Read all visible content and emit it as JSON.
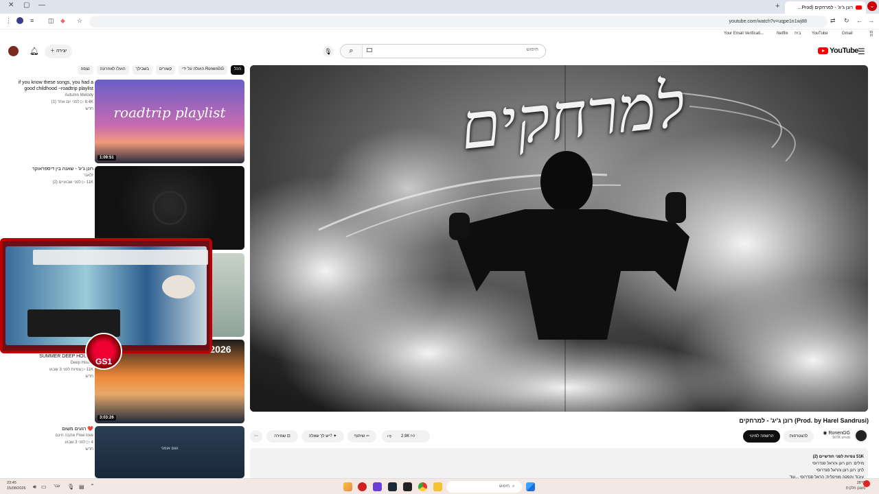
{
  "browser": {
    "tab_title": "רונן ג'יג' - למרחקים (Prod...",
    "url": "youtube.com/watch?v=uqpe1n1wj88",
    "bookmarks": [
      "Your Email Verificati...",
      "Netflix",
      "בית",
      "YouTube",
      "Gmail"
    ]
  },
  "header": {
    "search_placeholder": "חיפוש",
    "create_label": "יצירה",
    "logo_text": "YouTube"
  },
  "chips": [
    "הכל",
    "RonenGG",
    "הועלה על ידי",
    "קשורים",
    "בשבילך",
    "הועלו לאחרונה",
    "נצפה"
  ],
  "recommendations": [
    {
      "title": "if you know these songs, you had a good childhood ~roadtrip playlist",
      "channel": "Autumn Melody",
      "stats": "8.4K ▷ לפני יום אחד (1)",
      "badge": "חדש",
      "duration": "1:09:51",
      "thumb_text": "roadtrip playlist"
    },
    {
      "title": "רונן ג'יג' - שאנה בין דיספראוקר",
      "channel": "זלאנר",
      "stats": "11K ▷ לפני שבועיים (2)",
      "badge": "",
      "duration": "",
      "thumb_text": ""
    },
    {
      "title": "",
      "channel": "",
      "stats": "",
      "badge": "",
      "duration": "",
      "thumb_text": ""
    },
    {
      "title": "SUMMER DEEP HOUSE",
      "channel": "Deep House",
      "stats": "11K ▷ צפיות לפני 3 שבוע",
      "badge": "חדש",
      "duration": "3:03:26",
      "thumb_text": "MIX TOP 2026"
    },
    {
      "title": "❤️ רגעים משום",
      "channel": "Free love אהבה חינם",
      "stats": "4 ▷ לפני 3 שבוע",
      "badge": "חדש",
      "duration": "",
      "thumb_text": "ושם אומני"
    }
  ],
  "video": {
    "title": "רונן ג'יג' - למרחקים (Prod. by Harel Sandrusi)",
    "overlay_title": "למרחקים",
    "channel": "RonenGG",
    "subscribers": "507K מנויים",
    "subscribe_label": "הרשמה למינוי",
    "join_label": "להצטרפות",
    "likes": "2.9K",
    "share_label": "שיתוף",
    "ask_label": "יש לך שאלה?",
    "save_label": "שמירה",
    "more_label": "⋯"
  },
  "description": {
    "line1": "51K צפיות  לפני חודשיים (2)",
    "line2": "מילים: רונן רונן והראל סנדרוסי",
    "line3": "לחן: רונן רונן והראל סנדרוסי",
    "line4": "עיבוד והפקה מוזיקלית: הראל סנדרוסי ...עוד"
  },
  "overlay": {
    "badge_text": "GS1"
  },
  "taskbar": {
    "time": "23:45",
    "date": "15/08/2026",
    "search_placeholder": "חיפוש",
    "weather_temp": "28°C",
    "weather_desc": "מעונן חלקית",
    "lang": "עבר"
  },
  "colors": {
    "accent": "#ff0000",
    "dark": "#0f0f0f",
    "chip_bg": "#f2f2f2"
  }
}
